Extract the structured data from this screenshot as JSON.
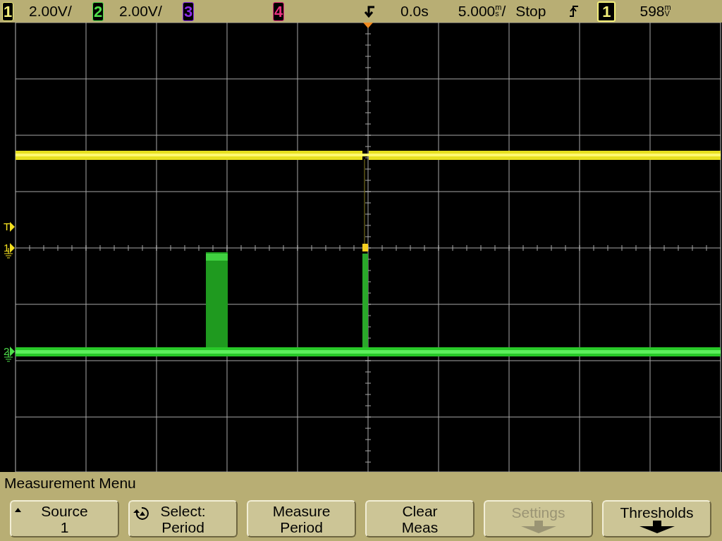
{
  "status_bar": {
    "channels": [
      {
        "number": "1",
        "scale": "2.00V/",
        "color": "#f4f07a"
      },
      {
        "number": "2",
        "scale": "2.00V/",
        "color": "#4ee04a"
      },
      {
        "number": "3",
        "color": "#8a2be8"
      },
      {
        "number": "4",
        "color": "#e8307e"
      }
    ],
    "delay": "0.0s",
    "timebase": {
      "value": "5.000",
      "unit_top": "m",
      "unit_bottom": "s",
      "suffix": "/"
    },
    "run_state": "Stop",
    "trigger": {
      "source": "1",
      "color": "#f4f07a",
      "level": {
        "value": "598",
        "unit_top": "m",
        "unit_bottom": "V"
      }
    }
  },
  "display": {
    "markers": [
      {
        "kind": "trigger",
        "label": "T",
        "color": "#f4e020"
      },
      {
        "kind": "ground",
        "label": "1",
        "color": "#f4e020"
      },
      {
        "kind": "ground",
        "label": "2",
        "color": "#4ee04a"
      }
    ]
  },
  "menu": {
    "title": "Measurement Menu",
    "softkeys": [
      {
        "kind": "pointer",
        "lines": [
          "Source",
          "1"
        ],
        "disabled": false
      },
      {
        "kind": "knob",
        "lines": [
          "Select:",
          "Period"
        ],
        "disabled": false
      },
      {
        "kind": "plain",
        "lines": [
          "Measure",
          "Period"
        ],
        "disabled": false
      },
      {
        "kind": "plain",
        "lines": [
          "Clear",
          "Meas"
        ],
        "disabled": false
      },
      {
        "kind": "submenu",
        "lines": [
          "Settings"
        ],
        "disabled": true
      },
      {
        "kind": "submenu",
        "lines": [
          "Thresholds"
        ],
        "disabled": false
      }
    ]
  }
}
